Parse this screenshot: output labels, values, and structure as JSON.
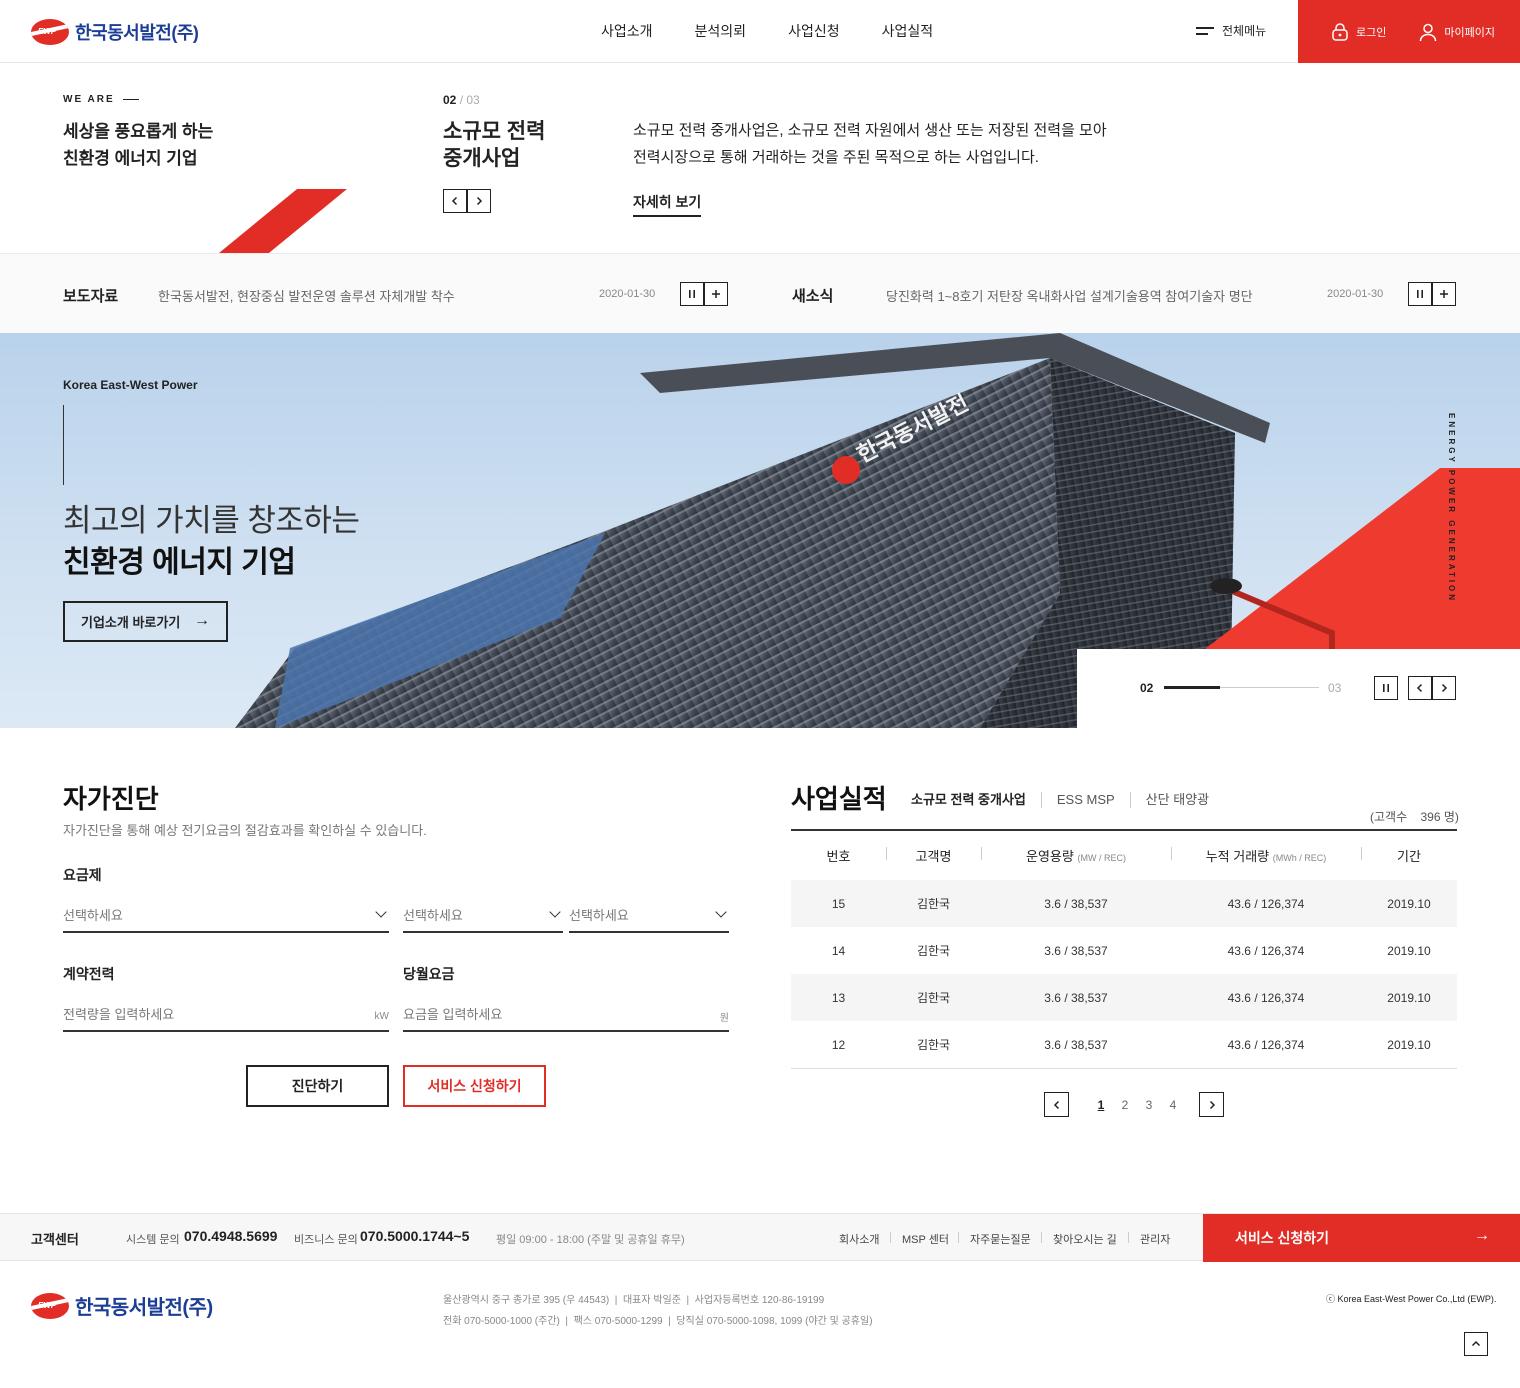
{
  "header": {
    "logo_text": "한국동서발전(주)",
    "logo_mark": "EWP",
    "nav": [
      "사업소개",
      "분석의뢰",
      "사업신청",
      "사업실적"
    ],
    "all_menu": "전체메뉴",
    "login": "로그인",
    "mypage": "마이페이지"
  },
  "intro": {
    "we_are": "WE ARE",
    "copy_line1": "세상을 풍요롭게 하는",
    "copy_line2": "친환경 에너지 기업",
    "pager_current": "02",
    "pager_total": "/ 03",
    "biz_name_line1": "소규모 전력",
    "biz_name_line2": "중개사업",
    "biz_desc_line1": "소규모 전력 중개사업은, 소규모 전력 자원에서 생산 또는 저장된 전력을 모아",
    "biz_desc_line2": "전력시장으로 통해 거래하는 것을 주된 목적으로 하는 사업입니다.",
    "more": "자세히 보기"
  },
  "newsbar": {
    "press": {
      "title": "보도자료",
      "text": "한국동서발전, 현장중심 발전운영 솔루션 자체개발 착수",
      "date": "2020-01-30"
    },
    "news": {
      "title": "새소식",
      "text": "당진화력 1~8호기 저탄장 옥내화사업 설계기술용역 참여기술자 명단",
      "date": "2020-01-30"
    }
  },
  "hero": {
    "company": "Korea East-West Power",
    "line1": "최고의 가치를 창조하는",
    "line2": "친환경 에너지 기업",
    "button": "기업소개 바로가기",
    "vertical_text": "ENERGY POWER GENERATION",
    "building_sign": "한국동서발전",
    "slide_current": "02",
    "slide_total": "03",
    "progress": 0.36
  },
  "diagnosis": {
    "title": "자가진단",
    "subtitle": "자가진단을 통해 예상 전기요금의 절감효과를 확인하실 수 있습니다.",
    "rate_label": "요금제",
    "select1": "선택하세요",
    "select2": "선택하세요",
    "select3": "선택하세요",
    "contract_label": "계약전력",
    "contract_placeholder": "전력량을 입력하세요",
    "contract_unit": "kW",
    "monthly_label": "당월요금",
    "monthly_placeholder": "요금을 입력하세요",
    "monthly_unit": "원",
    "diagnose_button": "진단하기",
    "apply_button": "서비스 신청하기"
  },
  "results": {
    "title": "사업실적",
    "tabs": [
      "소규모 전력 중개사업",
      "ESS MSP",
      "산단 태양광"
    ],
    "count_label": "(고객수",
    "count_value": "396 명)",
    "columns": {
      "no": "번호",
      "customer": "고객명",
      "capacity": "운영용량",
      "capacity_unit": "(MW / REC)",
      "volume": "누적 거래량",
      "volume_unit": "(MWh / REC)",
      "period": "기간"
    },
    "rows": [
      {
        "no": "15",
        "customer": "김한국",
        "capacity": "3.6 / 38,537",
        "volume": "43.6 / 126,374",
        "period": "2019.10"
      },
      {
        "no": "14",
        "customer": "김한국",
        "capacity": "3.6 / 38,537",
        "volume": "43.6 / 126,374",
        "period": "2019.10"
      },
      {
        "no": "13",
        "customer": "김한국",
        "capacity": "3.6 / 38,537",
        "volume": "43.6 / 126,374",
        "period": "2019.10"
      },
      {
        "no": "12",
        "customer": "김한국",
        "capacity": "3.6 / 38,537",
        "volume": "43.6 / 126,374",
        "period": "2019.10"
      }
    ],
    "pages": [
      "1",
      "2",
      "3",
      "4"
    ]
  },
  "contact": {
    "title": "고객센터",
    "system_label": "시스템 문의",
    "system_number": "070.4948.5699",
    "business_label": "비즈니스 문의",
    "business_number": "070.5000.1744~5",
    "hours": "평일 09:00 - 18:00 (주말 및 공휴일 휴무)",
    "links": [
      "회사소개",
      "MSP 센터",
      "자주묻는질문",
      "찾아오시는 길",
      "관리자"
    ],
    "apply": "서비스 신청하기"
  },
  "footer": {
    "logo_text": "한국동서발전(주)",
    "address": "울산광역시 중구 종가로 395 (우 44543)",
    "ceo": "대표자 박일준",
    "bizno": "사업자등록번호 120-86-19199",
    "tel": "전화 070-5000-1000 (주간)",
    "fax": "팩스 070-5000-1299",
    "duty": "당직실 070-5000-1098, 1099 (야간 및 공휴일)",
    "copyright": "ⓒ Korea East-West Power Co.,Ltd (EWP)."
  },
  "colors": {
    "accent": "#e22d26",
    "brand_blue": "#1d3e95",
    "text": "#222222"
  }
}
